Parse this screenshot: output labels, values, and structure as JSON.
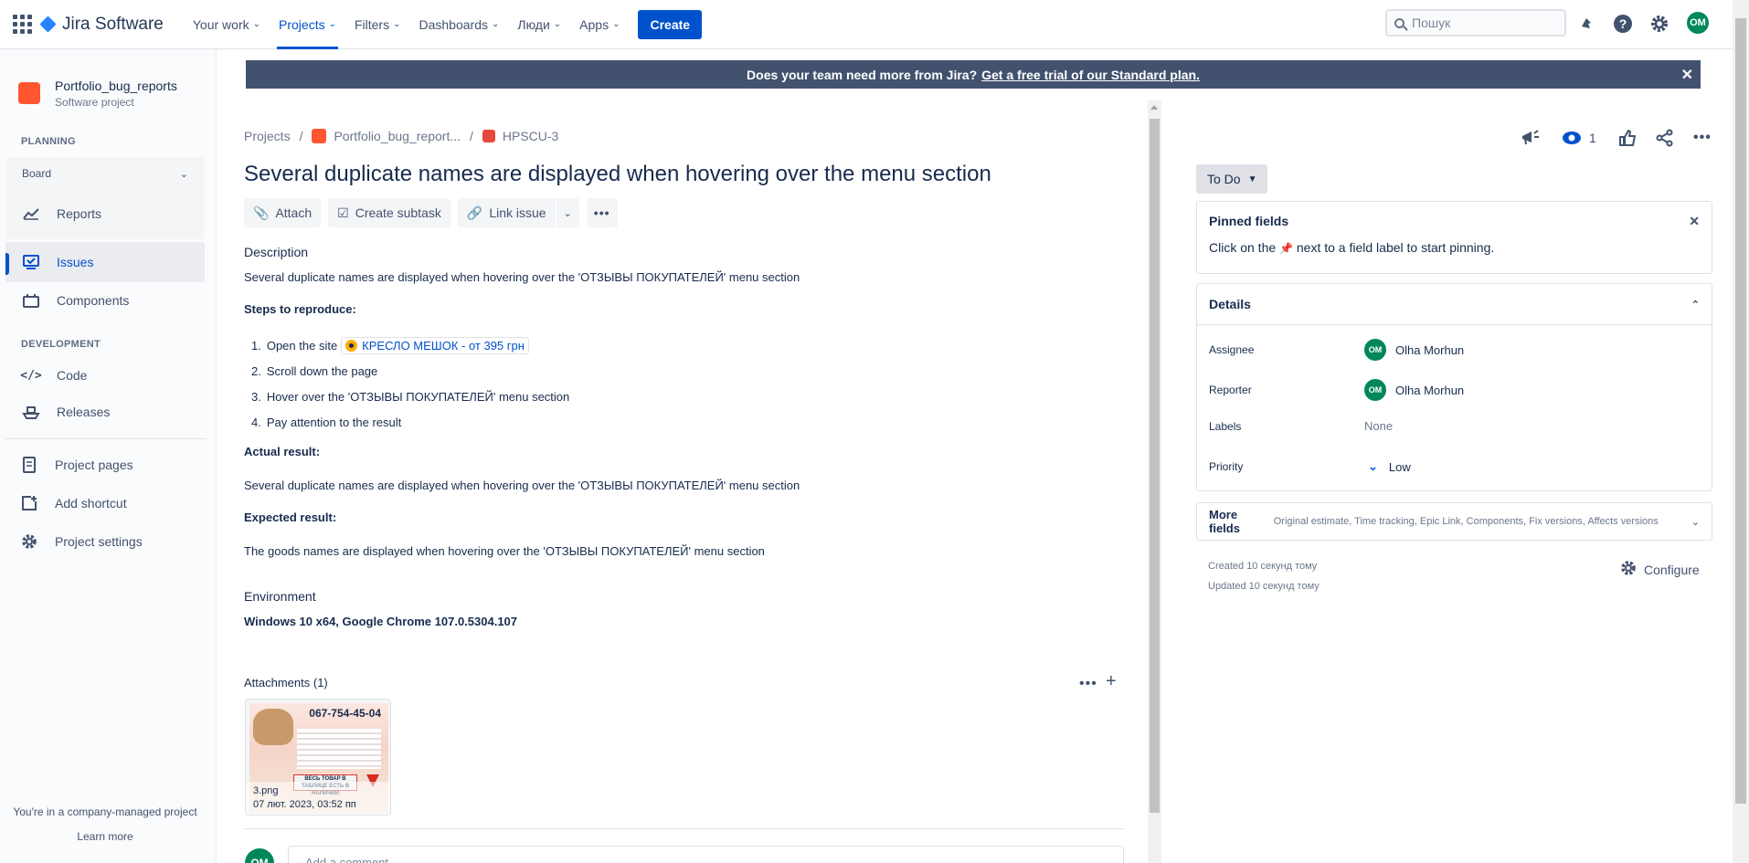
{
  "topnav": {
    "logo": "Jira Software",
    "items": [
      {
        "label": "Your work"
      },
      {
        "label": "Projects"
      },
      {
        "label": "Filters"
      },
      {
        "label": "Dashboards"
      },
      {
        "label": "Люди"
      },
      {
        "label": "Apps"
      }
    ],
    "create": "Create",
    "search_placeholder": "Пошук",
    "avatar": "OM"
  },
  "sidebar": {
    "project_name": "Portfolio_bug_reports",
    "project_type": "Software project",
    "planning_heading": "PLANNING",
    "board": "Board",
    "reports": "Reports",
    "issues": "Issues",
    "components": "Components",
    "development_heading": "DEVELOPMENT",
    "code": "Code",
    "releases": "Releases",
    "project_pages": "Project pages",
    "add_shortcut": "Add shortcut",
    "project_settings": "Project settings",
    "footer_text": "You're in a company-managed project",
    "learn_more": "Learn more"
  },
  "banner": {
    "text": "Does your team need more from Jira?",
    "link": "Get a free trial of our Standard plan."
  },
  "breadcrumb": {
    "projects": "Projects",
    "project": "Portfolio_bug_report...",
    "issue_key": "HPSCU-3"
  },
  "issue": {
    "title": "Several duplicate names are displayed when hovering over the menu section",
    "actions": {
      "attach": "Attach",
      "create_subtask": "Create subtask",
      "link_issue": "Link issue"
    },
    "description_label": "Description",
    "description": "Several duplicate names are displayed when hovering over the 'ОТЗЫВЫ ПОКУПАТЕЛЕЙ' menu section",
    "steps_label": "Steps to reproduce:",
    "steps": [
      {
        "num": "1.",
        "text": "Open the site",
        "link": "КРЕСЛО МЕШОК - от 395 грн"
      },
      {
        "num": "2.",
        "text": "Scroll down the page"
      },
      {
        "num": "3.",
        "text": "Hover over the 'ОТЗЫВЫ ПОКУПАТЕЛЕЙ' menu section"
      },
      {
        "num": "4.",
        "text": "Pay attention to the result"
      }
    ],
    "actual_label": "Actual result:",
    "actual": "Several duplicate names are displayed when hovering over the 'ОТЗЫВЫ ПОКУПАТЕЛЕЙ' menu section",
    "expected_label": "Expected result:",
    "expected": "The goods names are displayed when hovering over the 'ОТЗЫВЫ ПОКУПАТЕЛЕЙ' menu section",
    "environment_label": "Environment",
    "environment": "Windows 10 x64, Google Chrome 107.0.5304.107",
    "attachments_label": "Attachments (1)",
    "attachment": {
      "phone": "067-754-45-04",
      "banner_text": "ВЕСЬ ТОВАР В ТАБЛИЦЕ ЕСТЬ В НАЛИЧИИ",
      "filename": "3.png",
      "date": "07 лют. 2023, 03:52 пп"
    },
    "comment_avatar": "OM",
    "comment_placeholder": "Add a comment..."
  },
  "right_panel": {
    "watchers": "1",
    "status": "To Do",
    "pinned_title": "Pinned fields",
    "pinned_text_before": "Click on the",
    "pinned_text_after": "next to a field label to start pinning.",
    "details_title": "Details",
    "assignee_label": "Assignee",
    "assignee": "Olha Morhun",
    "reporter_label": "Reporter",
    "reporter": "Olha Morhun",
    "avatar": "OM",
    "labels_label": "Labels",
    "labels": "None",
    "priority_label": "Priority",
    "priority": "Low",
    "more_fields": "More fields",
    "more_fields_sub": "Original estimate, Time tracking, Epic Link, Components, Fix versions, Affects versions",
    "created": "Created 10 секунд тому",
    "updated": "Updated 10 секунд тому",
    "configure": "Configure"
  }
}
